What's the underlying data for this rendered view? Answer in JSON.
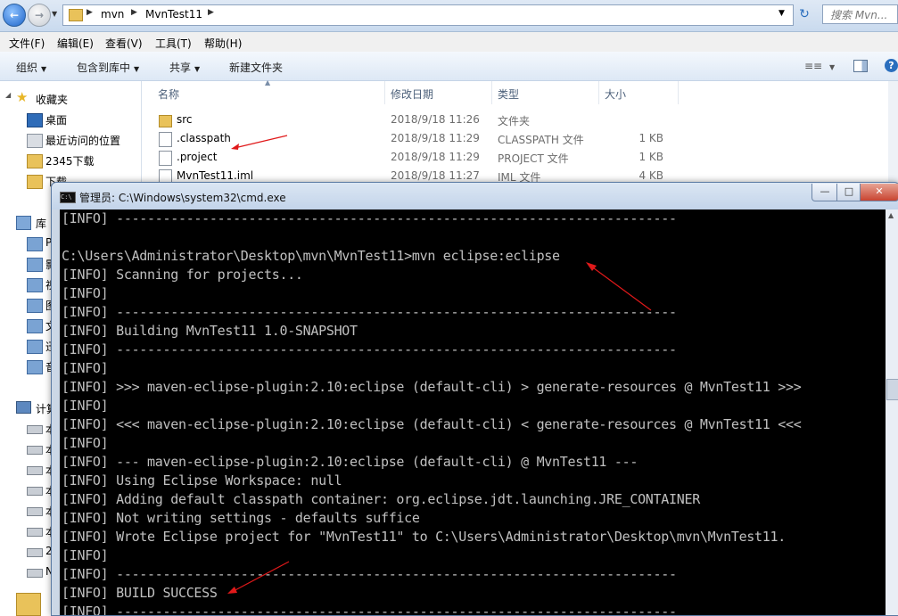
{
  "address_bar": {
    "crumbs": [
      "mvn",
      "MvnTest11"
    ],
    "search_placeholder": "搜索 Mvn..."
  },
  "menu": [
    "文件(F)",
    "编辑(E)",
    "查看(V)",
    "工具(T)",
    "帮助(H)"
  ],
  "toolbar": {
    "organize": "组织",
    "include_library": "包含到库中",
    "share": "共享",
    "new_folder": "新建文件夹"
  },
  "nav": {
    "favorites": "收藏夹",
    "items": [
      "桌面",
      "最近访问的位置",
      "2345下载",
      "下载"
    ],
    "library": "库",
    "lib_items": [
      "P",
      "影",
      "视",
      "图",
      "文",
      "迅",
      "音"
    ],
    "computer": "计算",
    "comp_items": [
      "本",
      "本",
      "本",
      "本",
      "本",
      "本",
      "2",
      "N"
    ]
  },
  "files": {
    "columns": [
      "名称",
      "修改日期",
      "类型",
      "大小"
    ],
    "rows": [
      {
        "name": "src",
        "date": "2018/9/18 11:26",
        "type": "文件夹",
        "size": "",
        "icon": "folder-icon"
      },
      {
        "name": ".classpath",
        "date": "2018/9/18 11:29",
        "type": "CLASSPATH 文件",
        "size": "1 KB",
        "icon": "file-icon"
      },
      {
        "name": ".project",
        "date": "2018/9/18 11:29",
        "type": "PROJECT 文件",
        "size": "1 KB",
        "icon": "file-icon"
      },
      {
        "name": "MvnTest11.iml",
        "date": "2018/9/18 11:27",
        "type": "IML 文件",
        "size": "4 KB",
        "icon": "file-icon"
      }
    ]
  },
  "cmd": {
    "title": "管理员: C:\\Windows\\system32\\cmd.exe",
    "lines": [
      "[INFO] ------------------------------------------------------------------------",
      "",
      "C:\\Users\\Administrator\\Desktop\\mvn\\MvnTest11>mvn eclipse:eclipse",
      "[INFO] Scanning for projects...",
      "[INFO]",
      "[INFO] ------------------------------------------------------------------------",
      "[INFO] Building MvnTest11 1.0-SNAPSHOT",
      "[INFO] ------------------------------------------------------------------------",
      "[INFO]",
      "[INFO] >>> maven-eclipse-plugin:2.10:eclipse (default-cli) > generate-resources @ MvnTest11 >>>",
      "[INFO]",
      "[INFO] <<< maven-eclipse-plugin:2.10:eclipse (default-cli) < generate-resources @ MvnTest11 <<<",
      "[INFO]",
      "[INFO] --- maven-eclipse-plugin:2.10:eclipse (default-cli) @ MvnTest11 ---",
      "[INFO] Using Eclipse Workspace: null",
      "[INFO] Adding default classpath container: org.eclipse.jdt.launching.JRE_CONTAINER",
      "[INFO] Not writing settings - defaults suffice",
      "[INFO] Wrote Eclipse project for \"MvnTest11\" to C:\\Users\\Administrator\\Desktop\\mvn\\MvnTest11.",
      "[INFO]",
      "[INFO] ------------------------------------------------------------------------",
      "[INFO] BUILD SUCCESS",
      "[INFO] ------------------------------------------------------------------------"
    ]
  },
  "colors": {
    "annotation_arrow": "#e0191a",
    "console_bg": "#000000",
    "console_text": "#c0c0c0"
  }
}
